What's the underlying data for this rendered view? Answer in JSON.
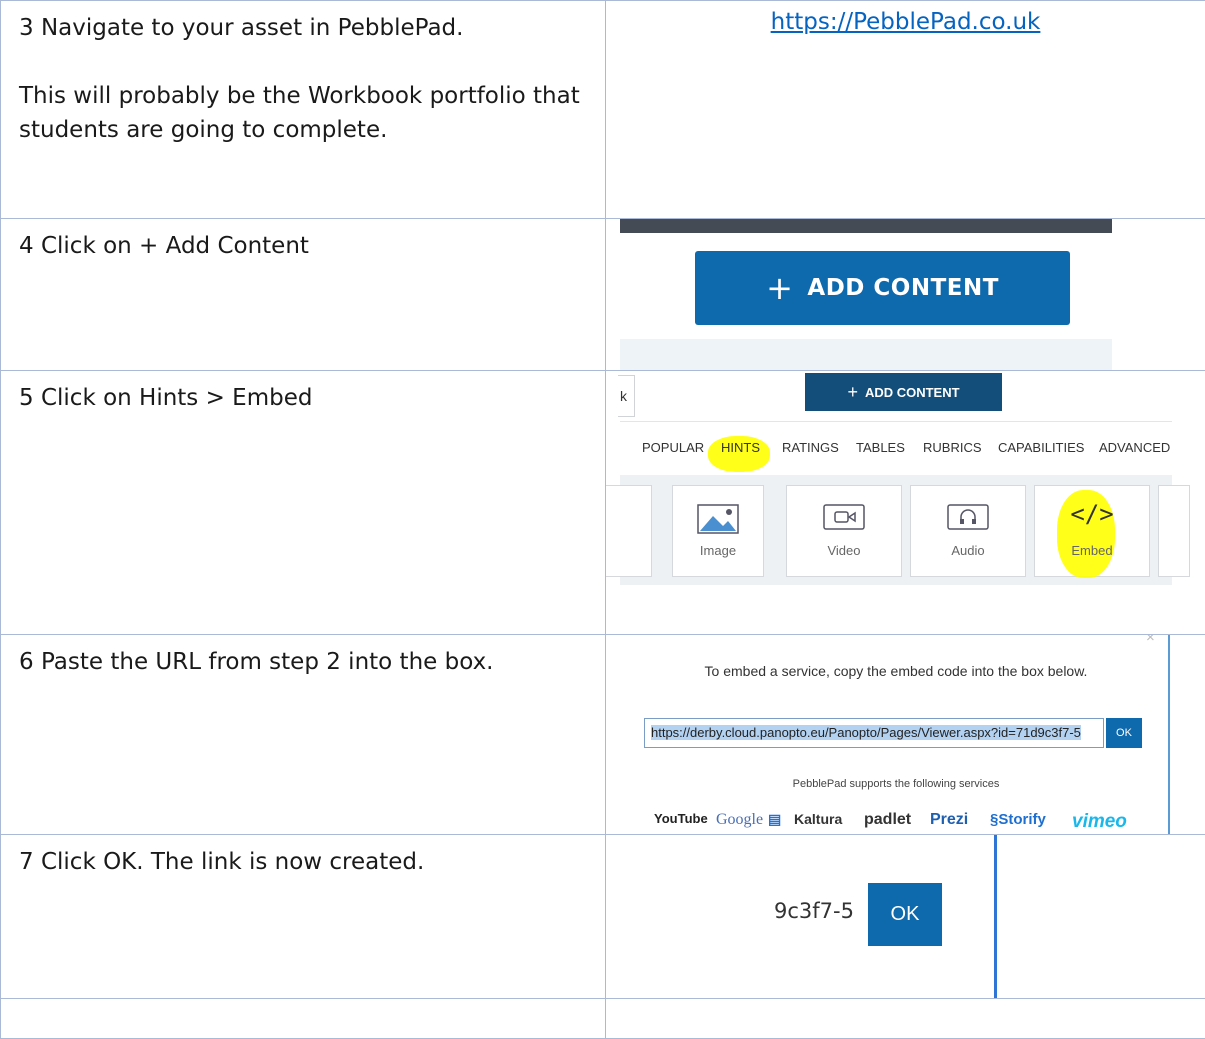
{
  "steps": [
    {
      "number": "3",
      "text": "Navigate to your asset in PebblePad.",
      "para": "This will probably be the Workbook portfolio that students are going to complete.",
      "link": "https://PebblePad.co.uk"
    },
    {
      "number": "4",
      "text": "Click on + Add Content",
      "button": "ADD CONTENT"
    },
    {
      "number": "5",
      "text": "Click on Hints > Embed",
      "button": "ADD CONTENT",
      "side_char": "k",
      "tabs": [
        "POPULAR",
        "HINTS",
        "RATINGS",
        "TABLES",
        "RUBRICS",
        "CAPABILITIES",
        "ADVANCED"
      ],
      "tiles": [
        "Image",
        "Video",
        "Audio",
        "Embed"
      ],
      "embed_glyph": "</>"
    },
    {
      "number": "6",
      "text": "Paste the URL from step 2 into the box.",
      "instruction": "To embed a service, copy the embed code into the box below.",
      "url": "https://derby.cloud.panopto.eu/Panopto/Pages/Viewer.aspx?id=71d9c3f7-5",
      "ok": "OK",
      "supports": "PebblePad supports the following services",
      "services": [
        "YouTube",
        "Google",
        "Kaltura",
        "padlet",
        "Prezi",
        "Storify",
        "vimeo"
      ],
      "close": "×"
    },
    {
      "number": "7",
      "text": "Click OK. The link is now created.",
      "fragment": "9c3f7-5",
      "ok": "OK"
    }
  ],
  "colors": {
    "accent": "#0f69ad",
    "dark_button": "#134d7a",
    "highlight": "#ffff00",
    "link": "#0563c1"
  }
}
